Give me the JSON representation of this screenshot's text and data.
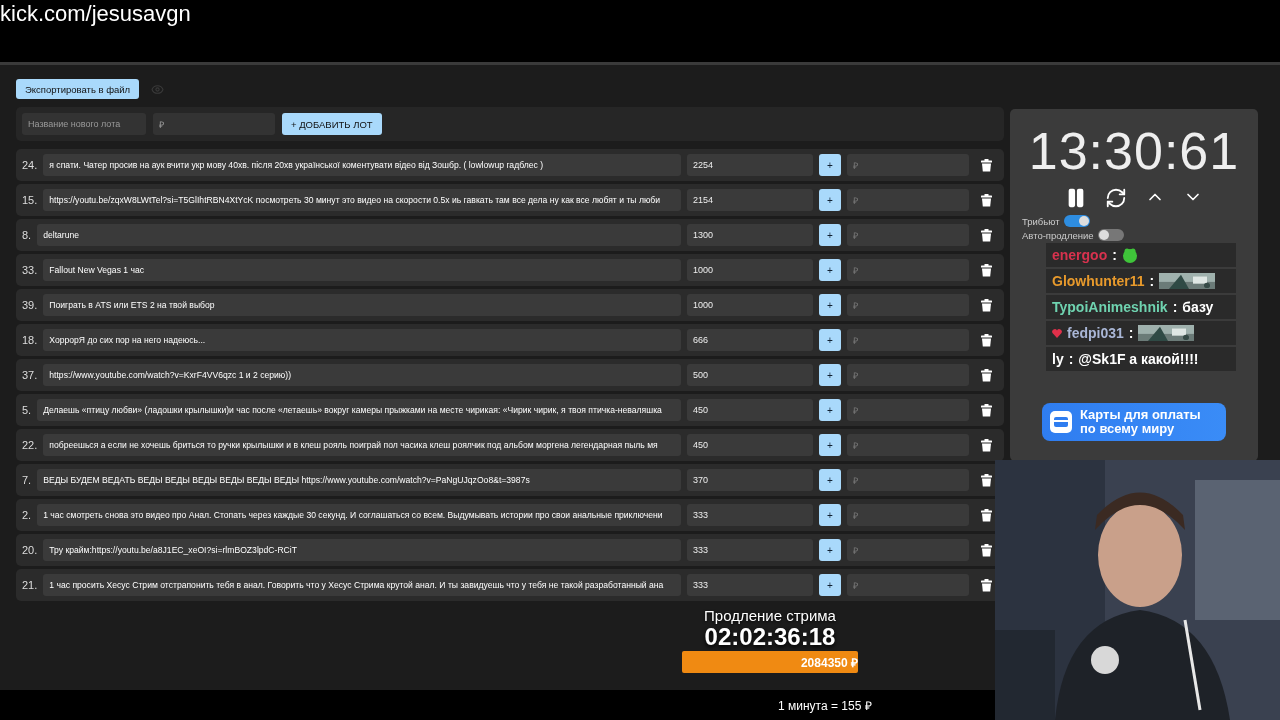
{
  "address": "kick.com/jesusavgn",
  "export_button": "Экспортировать в файл",
  "new_lot": {
    "name_placeholder": "Название нового лота",
    "price_placeholder": "₽",
    "add_button": "+ ДОБАВИТЬ ЛОТ"
  },
  "lots": [
    {
      "number": "24.",
      "title": "я спати. Чатер просив на аук вчити укр мову 40хв. після 20хв української коментувати відео від Зошбр. ( lowlowup гадблес )",
      "amount": "2254",
      "add": "+",
      "placeholder": "₽"
    },
    {
      "number": "15.",
      "title": "https://youtu.be/zqxW8LWtTel?si=T5GlIhtRBN4XtYcK посмотреть 30 минут это видео на скорости 0.5х иь гавкать там все дела ну как все любят и ты люби",
      "amount": "2154",
      "add": "+",
      "placeholder": "₽"
    },
    {
      "number": "8.",
      "title": "deltarune",
      "amount": "1300",
      "add": "+",
      "placeholder": "₽"
    },
    {
      "number": "33.",
      "title": "Fallout New Vegas 1 час",
      "amount": "1000",
      "add": "+",
      "placeholder": "₽"
    },
    {
      "number": "39.",
      "title": "Поиграть в ATS или ETS 2 на твой выбор",
      "amount": "1000",
      "add": "+",
      "placeholder": "₽"
    },
    {
      "number": "18.",
      "title": "ХоррорЯ до сих пор на него надеюсь...",
      "amount": "666",
      "add": "+",
      "placeholder": "₽"
    },
    {
      "number": "37.",
      "title": "https://www.youtube.com/watch?v=KxrF4VV6qzc 1 и 2 серию))",
      "amount": "500",
      "add": "+",
      "placeholder": "₽"
    },
    {
      "number": "5.",
      "title": "Делаешь «птицу любви» (ладошки крылышки)и час после «летаешь» вокруг камеры прыжками на месте чирикая: «Чирик чирик, я твоя птичка-неваляшка",
      "amount": "450",
      "add": "+",
      "placeholder": "₽"
    },
    {
      "number": "22.",
      "title": "побреешься а если не хочешь бриться то ручки крылышки и в клеш рояль поиграй пол часика клеш роялчик под альбом моргена легендарная пыль мя",
      "amount": "450",
      "add": "+",
      "placeholder": "₽"
    },
    {
      "number": "7.",
      "title": "ВЕДЫ БУДЕМ ВЕДАТЬ ВЕДЫ ВЕДЫ ВЕДЫ ВЕДЫ ВЕДЫ ВЕДЫ https://www.youtube.com/watch?v=PaNgUJqzOo8&t=3987s",
      "amount": "370",
      "add": "+",
      "placeholder": "₽"
    },
    {
      "number": "2.",
      "title": "1 час смотреть снова это видео про Анал. Стопать через каждые 30 секунд. И соглашаться со всем. Выдумывать истории про свои анальные приключени",
      "amount": "333",
      "add": "+",
      "placeholder": "₽"
    },
    {
      "number": "20.",
      "title": "Тру крайм:https://youtu.be/a8J1EC_xeOI?si=rlmBOZ3lpdC-RCiT",
      "amount": "333",
      "add": "+",
      "placeholder": "₽"
    },
    {
      "number": "21.",
      "title": "1 час просить Хесус Стрим отстрапонить тебя в анал. Говорить что у Хесус Стрима крутой анал. И ты завидуешь что у тебя не такой разработанный ана",
      "amount": "333",
      "add": "+",
      "placeholder": "₽"
    }
  ],
  "timer": {
    "time": "13:30:61"
  },
  "toggles": [
    {
      "label": "Трибьют",
      "on": true
    },
    {
      "label": "Авто-продление",
      "on": false
    }
  ],
  "chat": [
    {
      "user": "energoo",
      "color": "#d8324e",
      "badge": false,
      "separator": ":",
      "kind": "emote"
    },
    {
      "user": "Glowhunter11",
      "color": "#e89a2c",
      "badge": false,
      "separator": ":",
      "kind": "picture"
    },
    {
      "user": "TypoiAnimeshnik",
      "color": "#6fd3b0",
      "badge": false,
      "separator": ":",
      "kind": "text",
      "text": "базу"
    },
    {
      "user": "fedpi031",
      "color": "#a9b6d6",
      "badge": true,
      "separator": ":",
      "kind": "picture"
    },
    {
      "user": "ly",
      "color": "#ffffff",
      "badge": false,
      "separator": ":",
      "kind": "text",
      "text": "@Sk1F а какой!!!!"
    }
  ],
  "banner": {
    "line1": "Карты для оплаты",
    "line2": "по всему миру"
  },
  "extension": {
    "title": "Продление стрима",
    "time": "02:02:36:18",
    "total": "2084350 ₽"
  },
  "footer": "1 минута = 155 ₽"
}
